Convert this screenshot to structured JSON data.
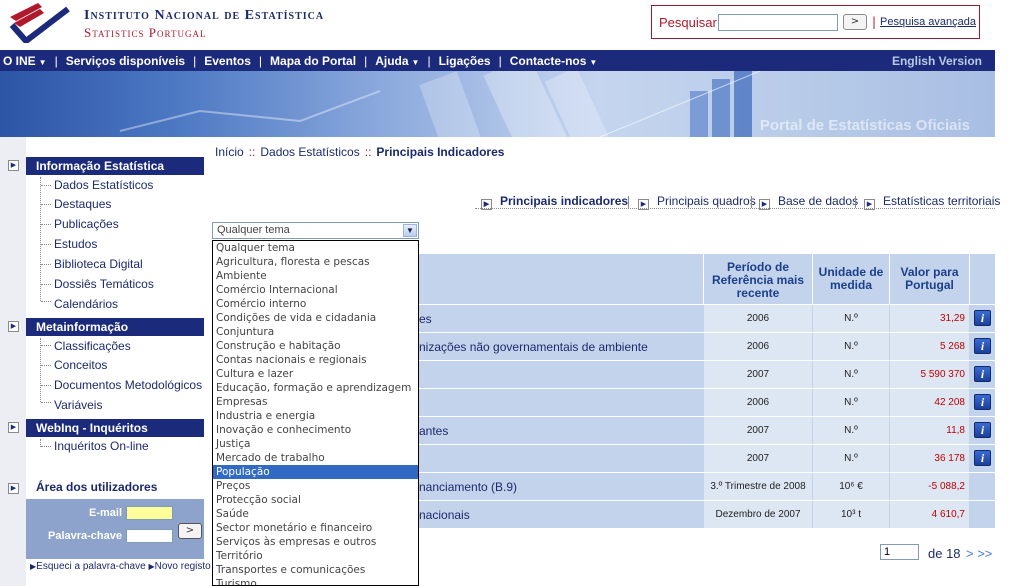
{
  "header": {
    "logo_line1": "Instituto Nacional de Estatística",
    "logo_line2": "Statistics Portugal",
    "search_label": "Pesquisar",
    "search_value": "",
    "search_go": ">",
    "search_sep": "|",
    "advanced_search": "Pesquisa avançada"
  },
  "nav": {
    "items": [
      "O INE",
      "Serviços disponíveis",
      "Eventos",
      "Mapa do Portal",
      "Ajuda",
      "Ligações",
      "Contacte-nos"
    ],
    "english": "English Version"
  },
  "banner": {
    "text": "Portal de Estatísticas Oficiais"
  },
  "sidebar": {
    "sections": [
      {
        "title": "Informação Estatística",
        "items": [
          "Dados Estatísticos",
          "Destaques",
          "Publicações",
          "Estudos",
          "Biblioteca Digital",
          "Dossiês Temáticos",
          "Calendários"
        ]
      },
      {
        "title": "Metainformação",
        "items": [
          "Classificações",
          "Conceitos",
          "Documentos Metodológicos",
          "Variáveis"
        ]
      },
      {
        "title": "WebInq - Inquéritos",
        "items": [
          "Inquéritos On-line"
        ]
      }
    ],
    "user_area": {
      "title": "Área dos utilizadores",
      "email_label": "E-mail",
      "password_label": "Palavra-chave",
      "go": ">",
      "forgot": "Esqueci a palavra-chave",
      "register": "Novo registo"
    }
  },
  "breadcrumb": {
    "home": "Início",
    "sep": "::",
    "level2": "Dados Estatísticos",
    "current": "Principais Indicadores"
  },
  "tabs": [
    "Principais indicadores",
    "Principais quadros",
    "Base de dados",
    "Estatísticas territoriais"
  ],
  "filter": {
    "selected": "Qualquer tema",
    "options": [
      "Qualquer tema",
      "Agricultura, floresta e pescas",
      "Ambiente",
      "Comércio Internacional",
      "Comércio interno",
      "Condições de vida e cidadania",
      "Conjuntura",
      "Construção e habitação",
      "Contas nacionais e regionais",
      "Cultura e lazer",
      "Educação, formação e aprendizagem",
      "Empresas",
      "Industria e energia",
      "Inovação e conhecimento",
      "Justiça",
      "Mercado de trabalho",
      "População",
      "Preços",
      "Protecção social",
      "Saúde",
      "Sector monetário e financeiro",
      "Serviços às empresas e outros",
      "Território",
      "Transportes e comunicações",
      "Turismo"
    ],
    "highlighted": "População"
  },
  "table": {
    "headers": {
      "period": "Período de Referência mais recente",
      "unit": "Unidade de medida",
      "value": "Valor para Portugal"
    },
    "rows": [
      {
        "desc": "es",
        "period": "2006",
        "unit": "N.º",
        "value": "31,29",
        "info": true
      },
      {
        "desc": "nizações não governamentais de ambiente",
        "period": "2006",
        "unit": "N.º",
        "value": "5 268",
        "info": true
      },
      {
        "desc": "",
        "period": "2007",
        "unit": "N.º",
        "value": "5 590 370",
        "info": true
      },
      {
        "desc": "",
        "period": "2006",
        "unit": "N.º",
        "value": "42 208",
        "info": true
      },
      {
        "desc": "antes",
        "period": "2007",
        "unit": "N.º",
        "value": "11,8",
        "info": true
      },
      {
        "desc": "",
        "period": "2007",
        "unit": "N.º",
        "value": "36 178",
        "info": true
      },
      {
        "desc": "nanciamento (B.9)",
        "period": "3.º Trimestre de 2008",
        "unit": "10⁶ €",
        "value": "-5 088,2",
        "info": false
      },
      {
        "desc": "nacionais",
        "period": "Dezembro de 2007",
        "unit": "10³ t",
        "value": "4 610,7",
        "info": false
      }
    ],
    "info_icon": "i"
  },
  "pager": {
    "page": "1",
    "total_label": "de 18",
    "next": "> >>"
  },
  "colors": {
    "navy": "#1b2a7b",
    "red": "#b0192c",
    "row_bg": "#c3d3ec",
    "value_red": "#c00000",
    "highlight": "#316ac5"
  }
}
